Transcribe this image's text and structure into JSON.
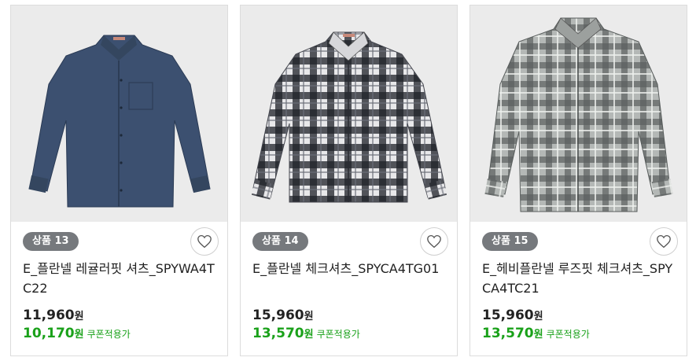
{
  "products": [
    {
      "badge": "상품 13",
      "name": "E_플란넬 레귤러핏 셔츠_SPYWA4TC22",
      "price": "11,960",
      "currency": "원",
      "coupon_price": "10,170",
      "coupon_label": "쿠폰적용가",
      "image": "navy-shirt",
      "colors": {
        "shirt": "#3c5070"
      }
    },
    {
      "badge": "상품 14",
      "name": "E_플란넬 체크셔츠_SPYCA4TG01",
      "price": "15,960",
      "currency": "원",
      "coupon_price": "13,570",
      "coupon_label": "쿠폰적용가",
      "image": "black-white-check-shirt",
      "colors": {
        "shirt": "#e8e8ea",
        "check": "#1f2128"
      }
    },
    {
      "badge": "상품 15",
      "name": "E_헤비플란넬 루즈핏 체크셔츠_SPYCA4TC21",
      "price": "15,960",
      "currency": "원",
      "coupon_price": "13,570",
      "coupon_label": "쿠폰적용가",
      "image": "grey-check-shirt",
      "colors": {
        "shirt": "#a6aaa8",
        "check": "#5b605f"
      }
    }
  ],
  "accent": {
    "coupon": "#1aa11a",
    "badge": "#76797d"
  }
}
